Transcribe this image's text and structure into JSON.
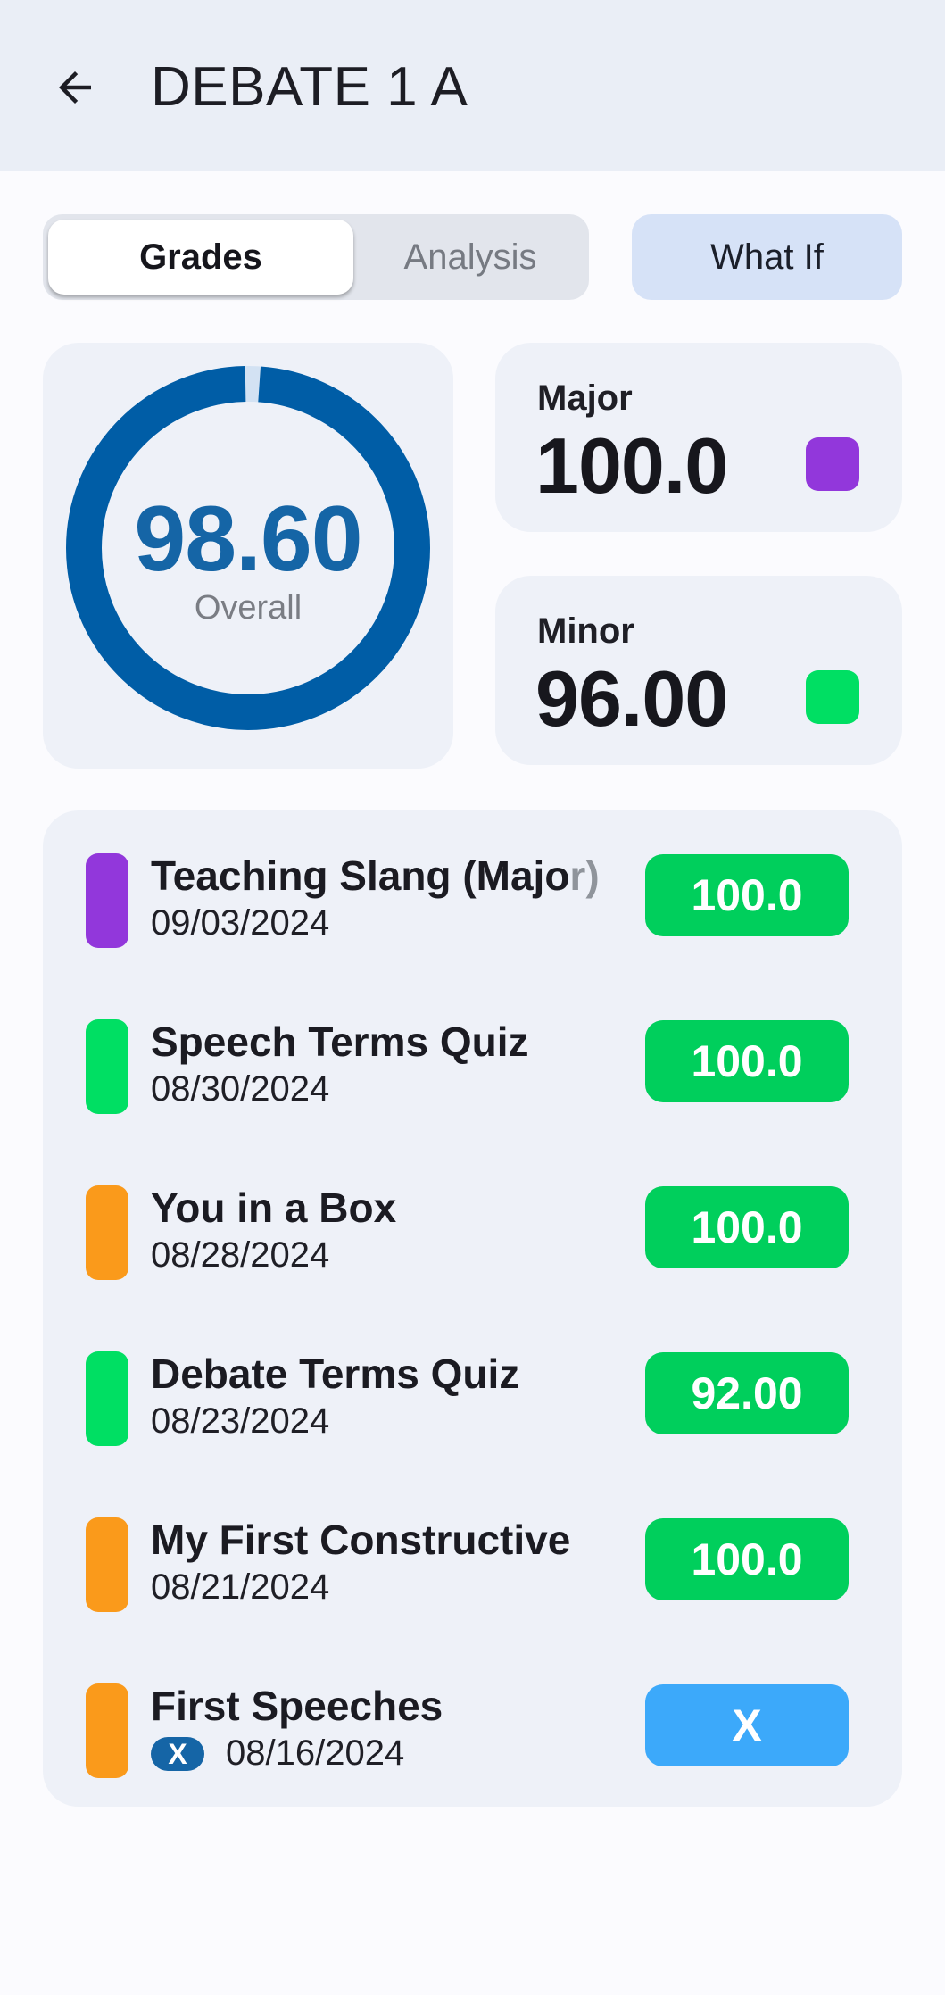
{
  "appbar": {
    "title": "DEBATE 1 A",
    "back_icon": "arrow-left-icon"
  },
  "tabs": {
    "items": [
      "Grades",
      "Analysis"
    ],
    "selected": "Grades"
  },
  "what_if": {
    "label": "What If"
  },
  "overall": {
    "value": "98.60",
    "label": "Overall",
    "fraction": 0.986,
    "ring_color": "#005da6",
    "track_color": "#d3e2f3"
  },
  "categories": [
    {
      "name": "Major",
      "value": "100.0",
      "color": "#9237db"
    },
    {
      "name": "Minor",
      "value": "96.00",
      "color": "#00df63"
    }
  ],
  "assignments": [
    {
      "title_main": "Teaching Slang (Majo",
      "title_fade": "r)",
      "date": "09/03/2024",
      "score": "100.0",
      "category_color": "#9237db",
      "score_color": "#00cf5c"
    },
    {
      "title_main": "Speech Terms Quiz",
      "title_fade": "",
      "date": "08/30/2024",
      "score": "100.0",
      "category_color": "#00df63",
      "score_color": "#00cf5c"
    },
    {
      "title_main": "You in a Box",
      "title_fade": "",
      "date": "08/28/2024",
      "score": "100.0",
      "category_color": "#fa9a1b",
      "score_color": "#00cf5c"
    },
    {
      "title_main": "Debate Terms Quiz",
      "title_fade": "",
      "date": "08/23/2024",
      "score": "92.00",
      "category_color": "#00df63",
      "score_color": "#00cf5c"
    },
    {
      "title_main": "My First Constructive",
      "title_fade": "",
      "date": "08/21/2024",
      "score": "100.0",
      "category_color": "#fa9a1b",
      "score_color": "#00cf5c"
    },
    {
      "title_main": "First Speeches",
      "title_fade": "",
      "badge": "X",
      "date": "08/16/2024",
      "score": "X",
      "category_color": "#fa9a1b",
      "score_color": "#3ca9fa"
    }
  ]
}
